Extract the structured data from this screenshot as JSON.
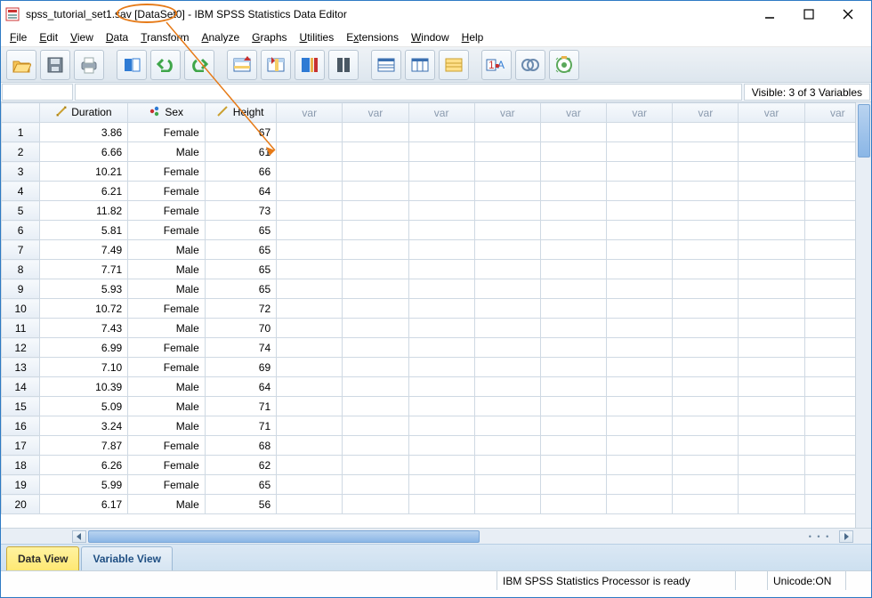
{
  "title": {
    "file": "spss_tutorial_set1.sav",
    "dataset": "[DataSet0]",
    "suffix": " - IBM SPSS Statistics Data Editor"
  },
  "menu": {
    "file": "File",
    "edit": "Edit",
    "view": "View",
    "data": "Data",
    "transform": "Transform",
    "analyze": "Analyze",
    "graphs": "Graphs",
    "utilities": "Utilities",
    "extensions": "Extensions",
    "window": "Window",
    "help": "Help"
  },
  "toolbar": {
    "icons": [
      "open",
      "save",
      "print",
      "recall",
      "undo",
      "redo",
      "goto-case",
      "goto-var",
      "variables",
      "find",
      "insert-case",
      "insert-var",
      "split-file",
      "weight",
      "select-cases",
      "value-labels",
      "use-sets"
    ]
  },
  "header_strip": {
    "visible_text": "Visible: 3 of 3 Variables"
  },
  "columns": {
    "defined": [
      "Duration",
      "Sex",
      "Height"
    ],
    "placeholder": "var",
    "placeholder_count": 9
  },
  "rows": [
    {
      "n": 1,
      "Duration": "3.86",
      "Sex": "Female",
      "Height": "67"
    },
    {
      "n": 2,
      "Duration": "6.66",
      "Sex": "Male",
      "Height": "61"
    },
    {
      "n": 3,
      "Duration": "10.21",
      "Sex": "Female",
      "Height": "66"
    },
    {
      "n": 4,
      "Duration": "6.21",
      "Sex": "Female",
      "Height": "64"
    },
    {
      "n": 5,
      "Duration": "11.82",
      "Sex": "Female",
      "Height": "73"
    },
    {
      "n": 6,
      "Duration": "5.81",
      "Sex": "Female",
      "Height": "65"
    },
    {
      "n": 7,
      "Duration": "7.49",
      "Sex": "Male",
      "Height": "65"
    },
    {
      "n": 8,
      "Duration": "7.71",
      "Sex": "Male",
      "Height": "65"
    },
    {
      "n": 9,
      "Duration": "5.93",
      "Sex": "Male",
      "Height": "65"
    },
    {
      "n": 10,
      "Duration": "10.72",
      "Sex": "Female",
      "Height": "72"
    },
    {
      "n": 11,
      "Duration": "7.43",
      "Sex": "Male",
      "Height": "70"
    },
    {
      "n": 12,
      "Duration": "6.99",
      "Sex": "Female",
      "Height": "74"
    },
    {
      "n": 13,
      "Duration": "7.10",
      "Sex": "Female",
      "Height": "69"
    },
    {
      "n": 14,
      "Duration": "10.39",
      "Sex": "Male",
      "Height": "64"
    },
    {
      "n": 15,
      "Duration": "5.09",
      "Sex": "Male",
      "Height": "71"
    },
    {
      "n": 16,
      "Duration": "3.24",
      "Sex": "Male",
      "Height": "71"
    },
    {
      "n": 17,
      "Duration": "7.87",
      "Sex": "Female",
      "Height": "68"
    },
    {
      "n": 18,
      "Duration": "6.26",
      "Sex": "Female",
      "Height": "62"
    },
    {
      "n": 19,
      "Duration": "5.99",
      "Sex": "Female",
      "Height": "65"
    },
    {
      "n": 20,
      "Duration": "6.17",
      "Sex": "Male",
      "Height": "56"
    }
  ],
  "tabs": {
    "data_view": "Data View",
    "variable_view": "Variable View",
    "active": "data_view"
  },
  "status": {
    "processor": "IBM SPSS Statistics Processor is ready",
    "unicode": "Unicode:ON"
  }
}
